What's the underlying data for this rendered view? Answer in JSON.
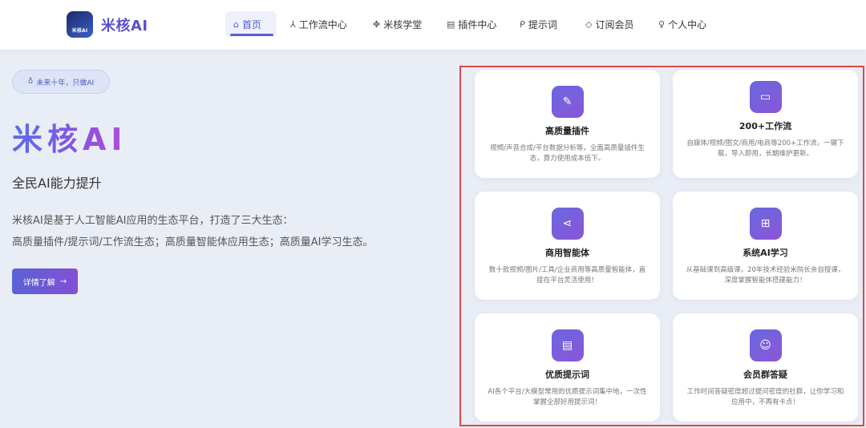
{
  "header": {
    "logo_text": "米核AI",
    "brand": "米核AI",
    "nav": [
      {
        "label": "首页",
        "icon": "home-icon",
        "active": true
      },
      {
        "label": "工作流中心",
        "icon": "workflow-icon"
      },
      {
        "label": "米核学堂",
        "icon": "school-icon"
      },
      {
        "label": "插件中心",
        "icon": "plugin-icon"
      },
      {
        "label": "提示词",
        "icon": "prompt-icon"
      },
      {
        "label": "订阅会员",
        "icon": "diamond-icon"
      },
      {
        "label": "个人中心",
        "icon": "user-icon"
      }
    ]
  },
  "hero": {
    "tag": "未来十年，只做AI",
    "title": "米核AI",
    "subtitle": "全民AI能力提升",
    "desc_line1": "米核AI是基于人工智能AI应用的生态平台，打造了三大生态：",
    "desc_line2": "高质量插件/提示词/工作流生态；高质量智能体应用生态；高质量AI学习生态。",
    "cta": "详情了解"
  },
  "features": [
    {
      "title": "高质量插件",
      "desc": "视频/声音合成/平台数据分析等，全面高质量插件生态，算力使用成本低下。",
      "icon": "edit-icon"
    },
    {
      "title": "200+工作流",
      "desc": "自媒体/视频/图文/商用/电商等200+工作流，一键下载，导入即用，长期维护更新。",
      "icon": "video-icon"
    },
    {
      "title": "商用智能体",
      "desc": "数十款视频/图片/工具/企业商用等高质量智能体，直接在平台灵活使用！",
      "icon": "share-icon"
    },
    {
      "title": "系统AI学习",
      "desc": "从基础课到高级课，20年技术经验米院长亲自授课，深度掌握智能体搭建能力！",
      "icon": "course-icon"
    },
    {
      "title": "优质提示词",
      "desc": "AI各个平台/大模型常用的优质提示词集中地，一次性掌握全部好用提示词！",
      "icon": "document-icon"
    },
    {
      "title": "会员群答疑",
      "desc": "工作时间答疑密度超过提问密度的社群，让你学习和应用中，不再有卡点！",
      "icon": "smile-icon"
    }
  ],
  "colors": {
    "accent": "#5b5fd6",
    "highlight_border": "#e04848"
  }
}
